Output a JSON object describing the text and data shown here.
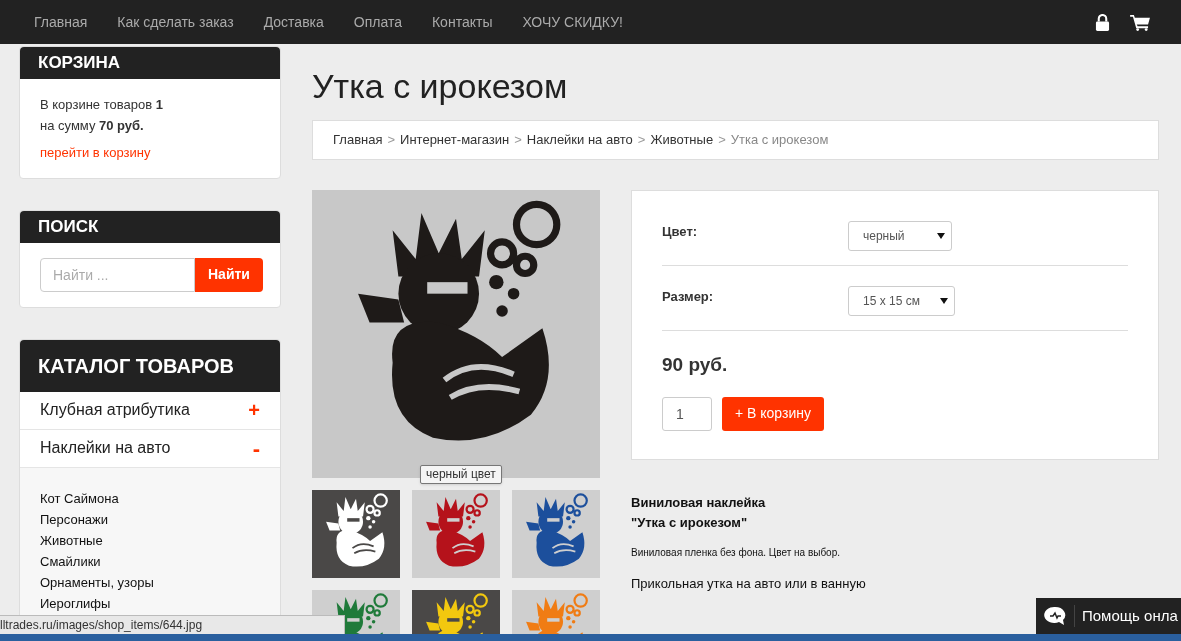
{
  "nav": {
    "links": [
      "Главная",
      "Как сделать заказ",
      "Доставка",
      "Оплата",
      "Контакты",
      "ХОЧУ СКИДКУ!"
    ]
  },
  "cart": {
    "title": "КОРЗИНА",
    "count_text": "В корзине товаров **1**",
    "sum_text": "на сумму **70 руб.**",
    "link": "перейти в корзину"
  },
  "search": {
    "title": "ПОИСК",
    "placeholder": "Найти ...",
    "button": "Найти"
  },
  "catalog": {
    "title": "КАТАЛОГ ТОВАРОВ",
    "items": [
      {
        "label": "Клубная атрибутика",
        "expanded": false,
        "toggle": "+"
      },
      {
        "label": "Наклейки на авто",
        "expanded": true,
        "toggle": "-",
        "children": [
          {
            "label": "Кот Саймона"
          },
          {
            "label": "Персонажи"
          },
          {
            "label": "Животные"
          },
          {
            "label": "Смайлики"
          },
          {
            "label": "Орнаменты, узоры"
          },
          {
            "label": "Иероглифы"
          }
        ]
      }
    ]
  },
  "product": {
    "title": "Утка с ирокезом",
    "breadcrumb": [
      {
        "kind": "link",
        "label": "Главная"
      },
      {
        "kind": "separator",
        "label": ">"
      },
      {
        "kind": "link",
        "label": "Интернет-магазин"
      },
      {
        "kind": "separator",
        "label": ">"
      },
      {
        "kind": "link",
        "label": "Наклейки на авто"
      },
      {
        "kind": "separator",
        "label": ">"
      },
      {
        "kind": "link",
        "label": "Животные"
      },
      {
        "kind": "separator",
        "label": ">"
      },
      {
        "kind": "current",
        "label": "Утка с ирокезом"
      }
    ],
    "main_image": {
      "color": "#1e1a18"
    },
    "tooltip": "черный цвет",
    "thumbnails": [
      {
        "color": "#ffffff",
        "dark": true
      },
      {
        "color": "#b5121b",
        "dark": false
      },
      {
        "color": "#1c4f9c",
        "dark": false
      },
      {
        "color": "#1f7a3a",
        "dark": false
      },
      {
        "color": "#f2c80f",
        "dark": true
      },
      {
        "color": "#f07c14",
        "dark": false
      }
    ],
    "options": [
      {
        "label": "Цвет:",
        "value": "черный"
      },
      {
        "label": "Размер:",
        "value": "15 x 15 см"
      }
    ],
    "price": "90 руб.",
    "quantity": "1",
    "add_button": "+ В корзину",
    "description_title": [
      "Виниловая наклейка",
      "\"Утка с ирокезом\""
    ],
    "description_note": "Виниловая пленка без фона. Цвет на выбор.",
    "description_text": "Прикольная утка на авто или в ванную"
  },
  "status_bar": "lltrades.ru/images/shop_items/644.jpg",
  "chat_widget": "Помощь онла"
}
